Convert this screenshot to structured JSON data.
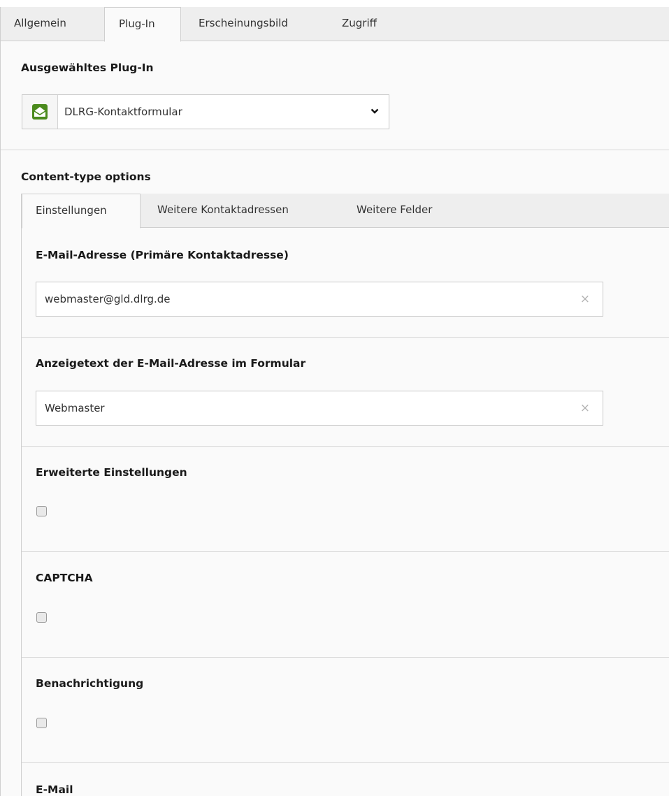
{
  "tabs": [
    "Allgemein",
    "Plug-In",
    "Erscheinungsbild",
    "Zugriff"
  ],
  "active_tab": "Plug-In",
  "plugin_section": {
    "title": "Ausgewähltes Plug-In",
    "selected": "DLRG-Kontaktformular",
    "icon": "envelope-open-icon",
    "icon_color": "#4a8a1c"
  },
  "content_type": {
    "title": "Content-type options",
    "subtabs": [
      "Einstellungen",
      "Weitere Kontaktadressen",
      "Weitere Felder"
    ],
    "active_subtab": "Einstellungen"
  },
  "fields": {
    "email": {
      "label": "E-Mail-Adresse (Primäre Kontaktadresse)",
      "value": "webmaster@gld.dlrg.de"
    },
    "display": {
      "label": "Anzeigetext der E-Mail-Adresse im Formular",
      "value": "Webmaster"
    },
    "advanced": {
      "label": "Erweiterte Einstellungen",
      "checked": false
    },
    "captcha": {
      "label": "CAPTCHA",
      "checked": false
    },
    "notify": {
      "label": "Benachrichtigung",
      "checked": false
    },
    "email2": {
      "label": "E-Mail"
    }
  },
  "clear_glyph": "×"
}
